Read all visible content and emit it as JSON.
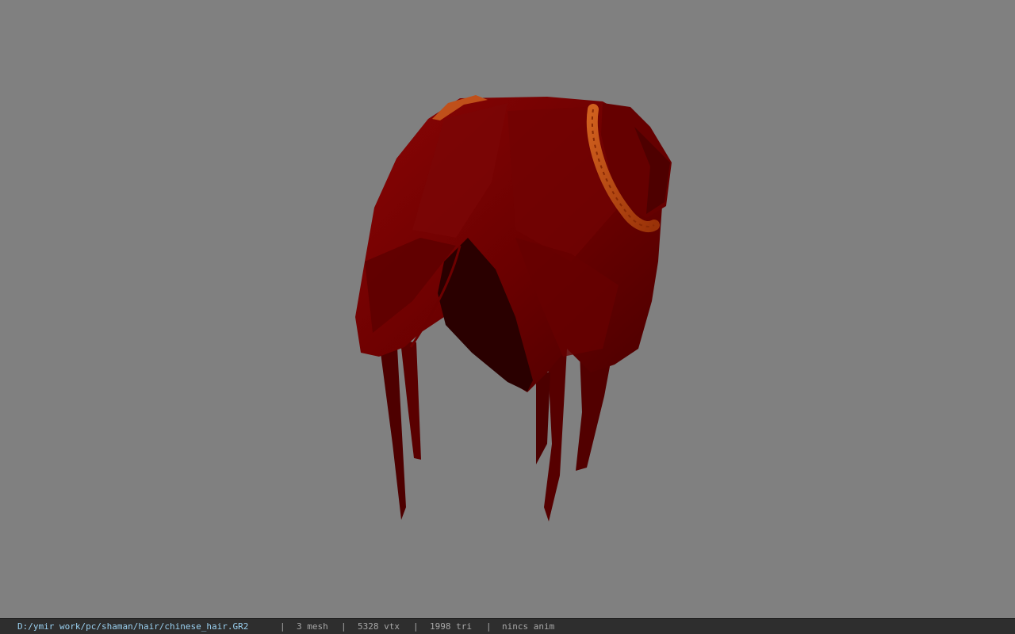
{
  "viewport": {
    "background": "#808080",
    "model_colors": {
      "hair_dark": "#4a0000",
      "hair_mid": "#6a0000",
      "hair_light": "#7d0a0a",
      "band": "#b8430f",
      "band_light": "#d0601e",
      "interior": "#250000"
    }
  },
  "status_bar": {
    "file_path": "D:/ymir work/pc/shaman/hair/chinese_hair.GR2",
    "separator": "|",
    "mesh_count": "3 mesh",
    "vertex_count": "5328 vtx",
    "triangle_count": "1998 tri",
    "anim_status": "nincs anim"
  }
}
